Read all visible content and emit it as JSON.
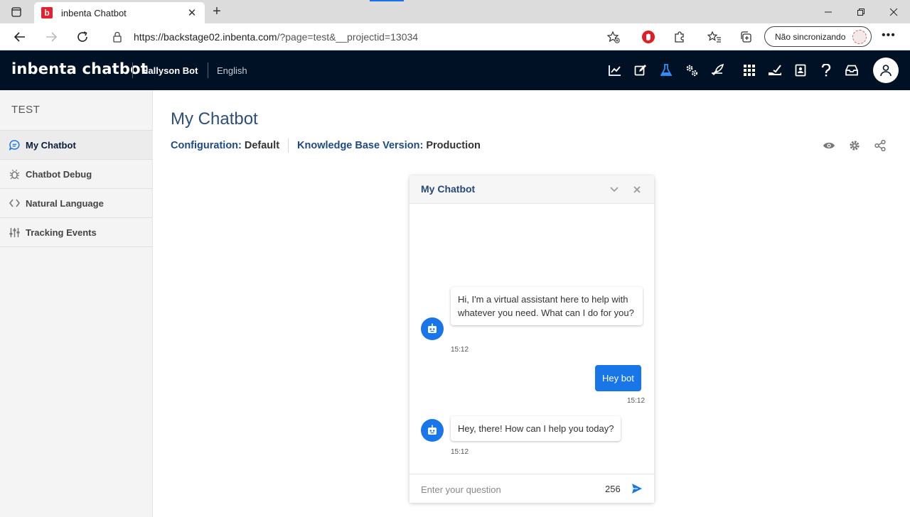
{
  "browser": {
    "tab_title": "inbenta Chatbot",
    "favicon_letter": "b",
    "url_host": "https://backstage02.inbenta.com",
    "url_path": "/?page=test&__projectid=13034",
    "sync_label": "Não sincronizando"
  },
  "header": {
    "logo": "inbenta chatbot",
    "bot_name": "Hallyson Bot",
    "language": "English",
    "icons": [
      "analytics-icon",
      "edit-icon",
      "flask-icon",
      "settings-icon",
      "deploy-icon",
      "apps-icon",
      "service-icon",
      "book-icon",
      "help-icon",
      "inbox-icon",
      "user-icon"
    ],
    "accent_color": "#1976e8"
  },
  "sidebar": {
    "title": "TEST",
    "items": [
      {
        "label": "My Chatbot",
        "icon": "chat-icon",
        "active": true
      },
      {
        "label": "Chatbot Debug",
        "icon": "bug-icon",
        "active": false
      },
      {
        "label": "Natural Language",
        "icon": "code-icon",
        "active": false
      },
      {
        "label": "Tracking Events",
        "icon": "sliders-icon",
        "active": false
      }
    ]
  },
  "main": {
    "title": "My Chatbot",
    "config_label": "Configuration:",
    "config_value": "Default",
    "kb_label": "Knowledge Base Version:",
    "kb_value": "Production"
  },
  "chat": {
    "title": "My Chatbot",
    "messages": [
      {
        "from": "bot",
        "text": "Hi, I'm a virtual assistant here to help with whatever you need. What can I do for you?",
        "time": "15:12"
      },
      {
        "from": "user",
        "text": "Hey bot",
        "time": "15:12"
      },
      {
        "from": "bot",
        "text": "Hey, there! How can I help you today?",
        "time": "15:12"
      }
    ],
    "input_placeholder": "Enter your question",
    "char_count": "256"
  }
}
